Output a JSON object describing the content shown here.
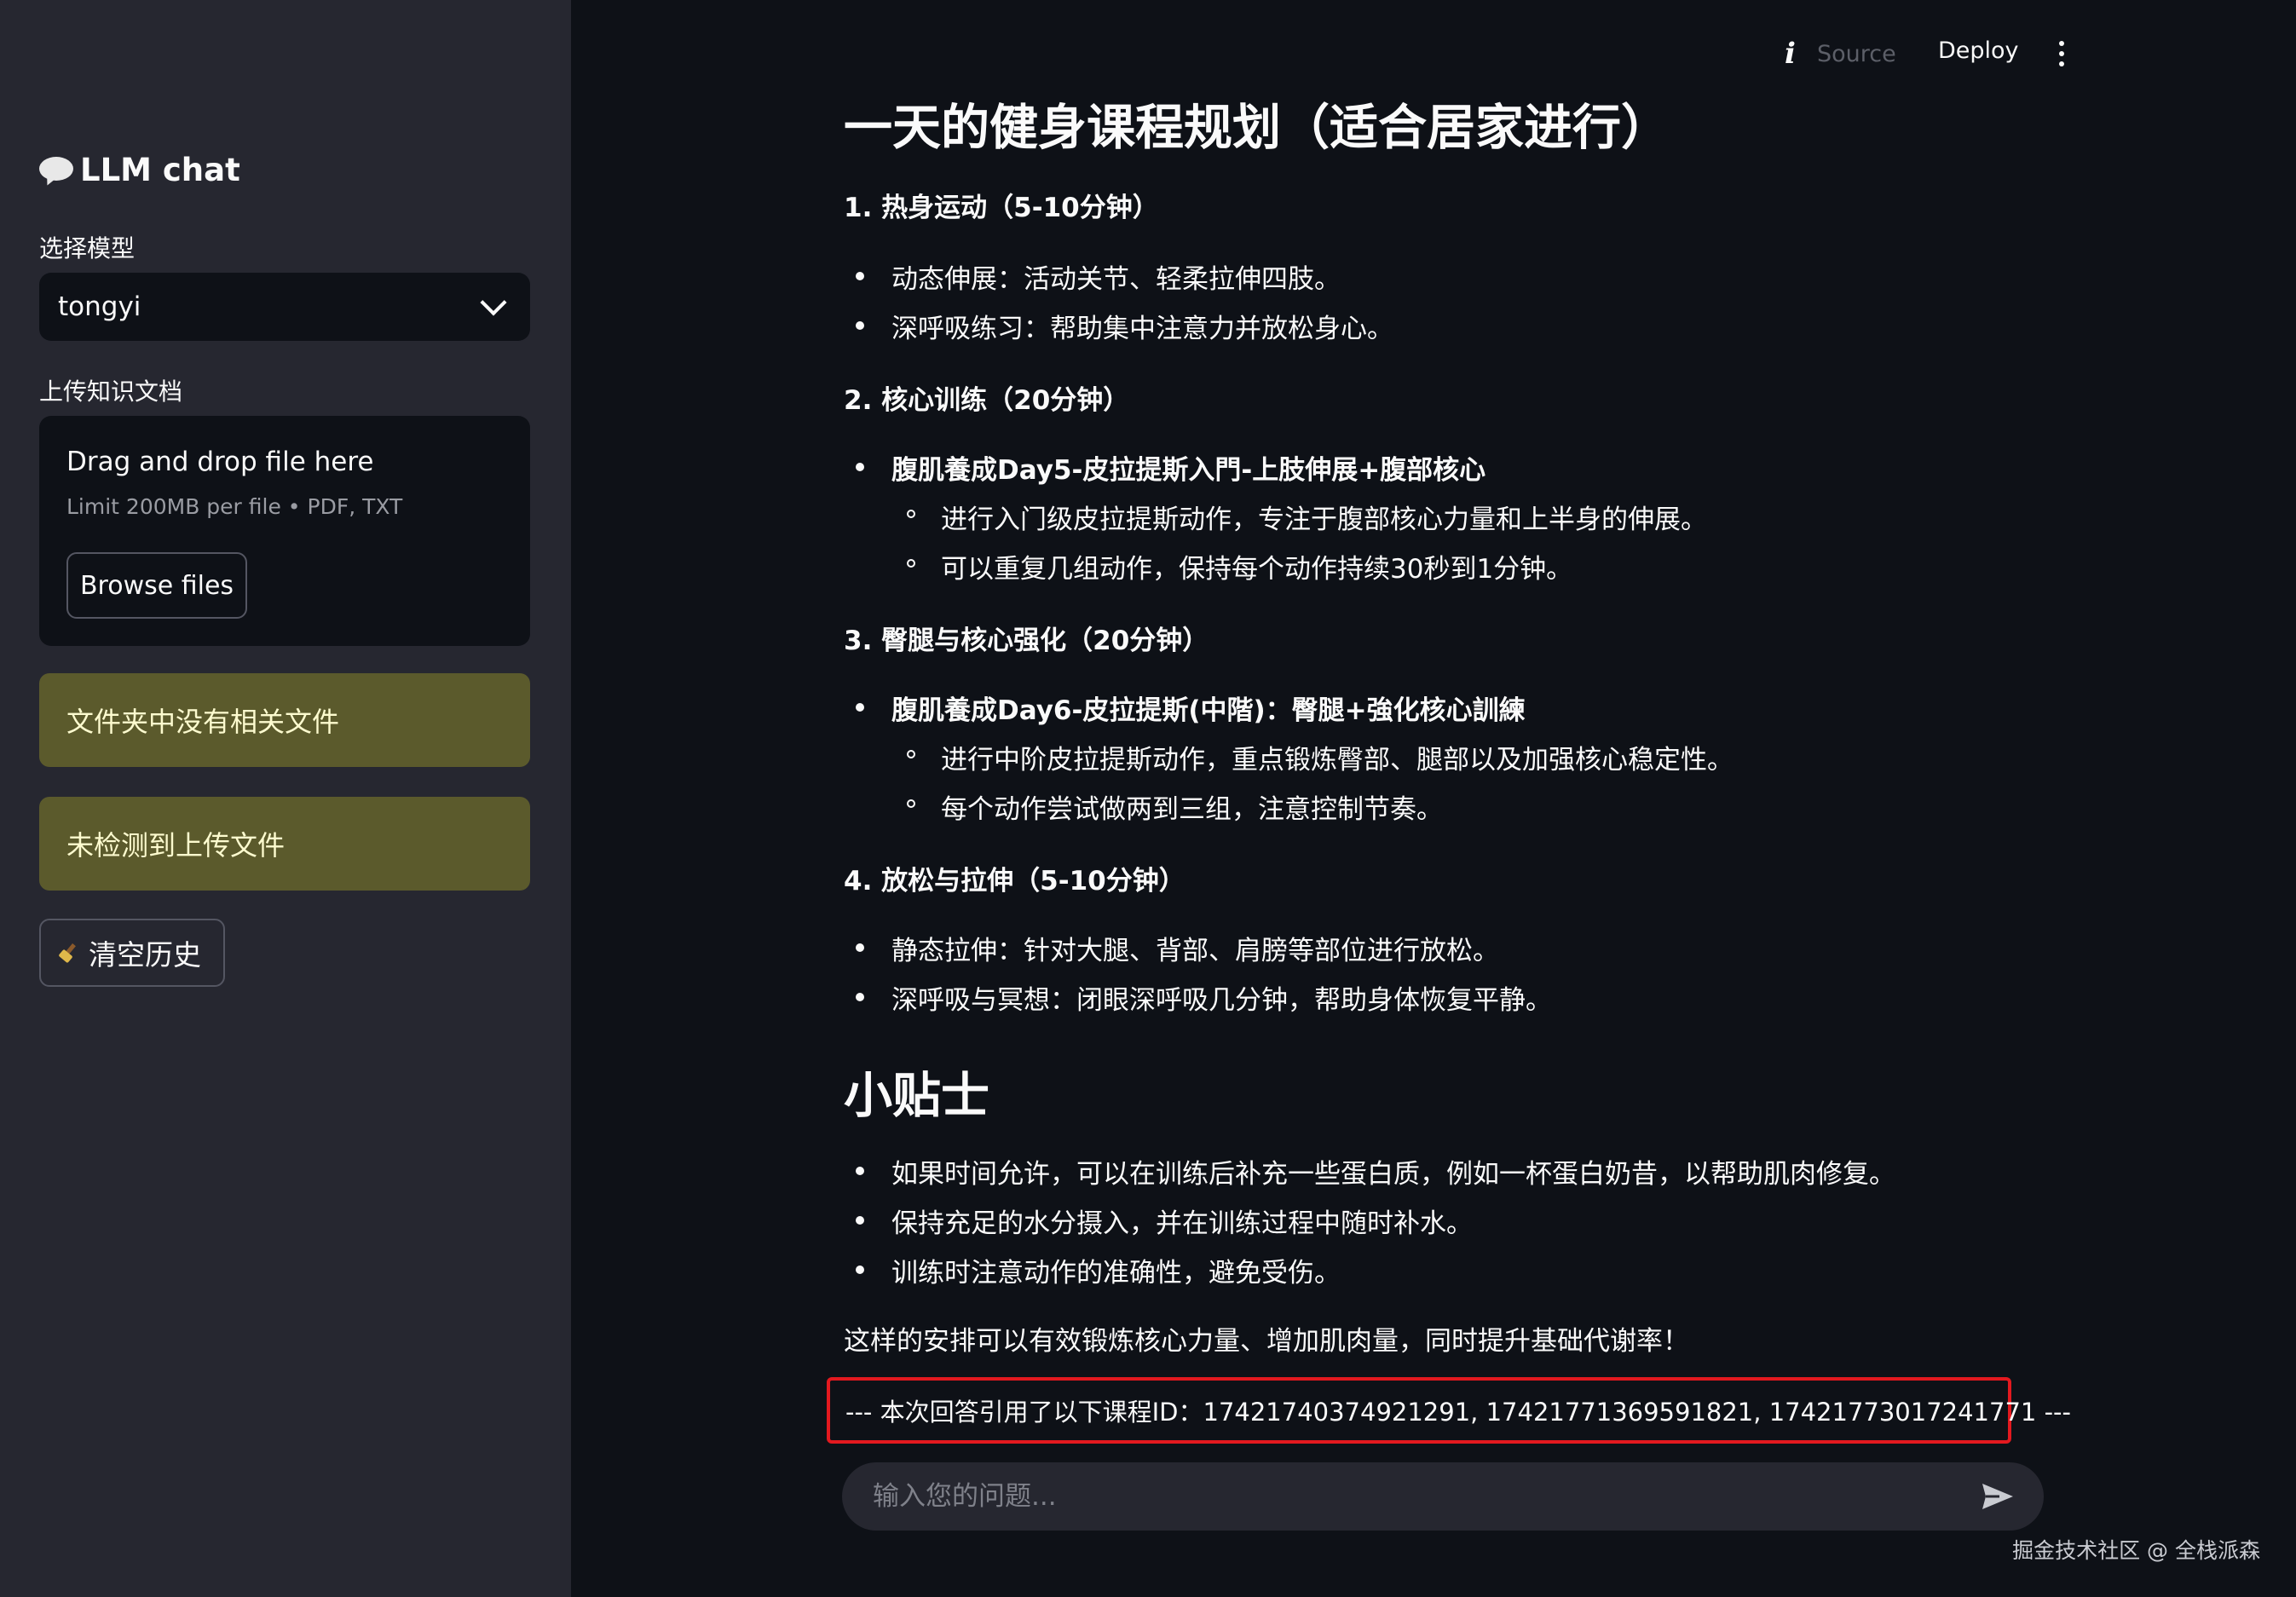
{
  "sidebar": {
    "title": "LLM chat",
    "model_label": "选择模型",
    "model_value": "tongyi",
    "upload_label": "上传知识文档",
    "uploader_title": "Drag and drop file here",
    "uploader_limit": "Limit 200MB per file • PDF, TXT",
    "browse_label": "Browse files",
    "warning_1": "文件夹中没有相关文件",
    "warning_2": "未检测到上传文件",
    "clear_label": "清空历史"
  },
  "header": {
    "ghost_text": "Source",
    "deploy_label": "Deploy"
  },
  "main": {
    "title": "一天的健身课程规划（适合居家进行）",
    "s1": "1. 热身运动（5-10分钟）",
    "s1_items": [
      "动态伸展：活动关节、轻柔拉伸四肢。",
      "深呼吸练习：帮助集中注意力并放松身心。"
    ],
    "s2": "2. 核心训练（20分钟）",
    "s2_item": "腹肌養成Day5-皮拉提斯入門-上肢伸展+腹部核心",
    "s2_subs": [
      "进行入门级皮拉提斯动作，专注于腹部核心力量和上半身的伸展。",
      "可以重复几组动作，保持每个动作持续30秒到1分钟。"
    ],
    "s3": "3. 臀腿与核心强化（20分钟）",
    "s3_item": "腹肌養成Day6-皮拉提斯(中階)：臀腿+強化核心訓練",
    "s3_subs": [
      "进行中阶皮拉提斯动作，重点锻炼臀部、腿部以及加强核心稳定性。",
      "每个动作尝试做两到三组，注意控制节奏。"
    ],
    "s4": "4. 放松与拉伸（5-10分钟）",
    "s4_items": [
      "静态拉伸：针对大腿、背部、肩膀等部位进行放松。",
      "深呼吸与冥想：闭眼深呼吸几分钟，帮助身体恢复平静。"
    ],
    "tips_title": "小贴士",
    "tips": [
      "如果时间允许，可以在训练后补充一些蛋白质，例如一杯蛋白奶昔，以帮助肌肉修复。",
      "保持充足的水分摄入，并在训练过程中随时补水。",
      "训练时注意动作的准确性，避免受伤。"
    ],
    "summary": "这样的安排可以有效锻炼核心力量、增加肌肉量，同时提升基础代谢率！",
    "citation": "--- 本次回答引用了以下课程ID：17421740374921291, 17421771369591821, 17421773017241771 ---"
  },
  "chat_input": {
    "placeholder": "输入您的问题..."
  },
  "watermark": "掘金技术社区 @ 全栈派森",
  "colors": {
    "background": "#0e1117",
    "sidebar": "#262730",
    "warning": "#5b5a2c",
    "highlight_border": "#e3191f"
  }
}
